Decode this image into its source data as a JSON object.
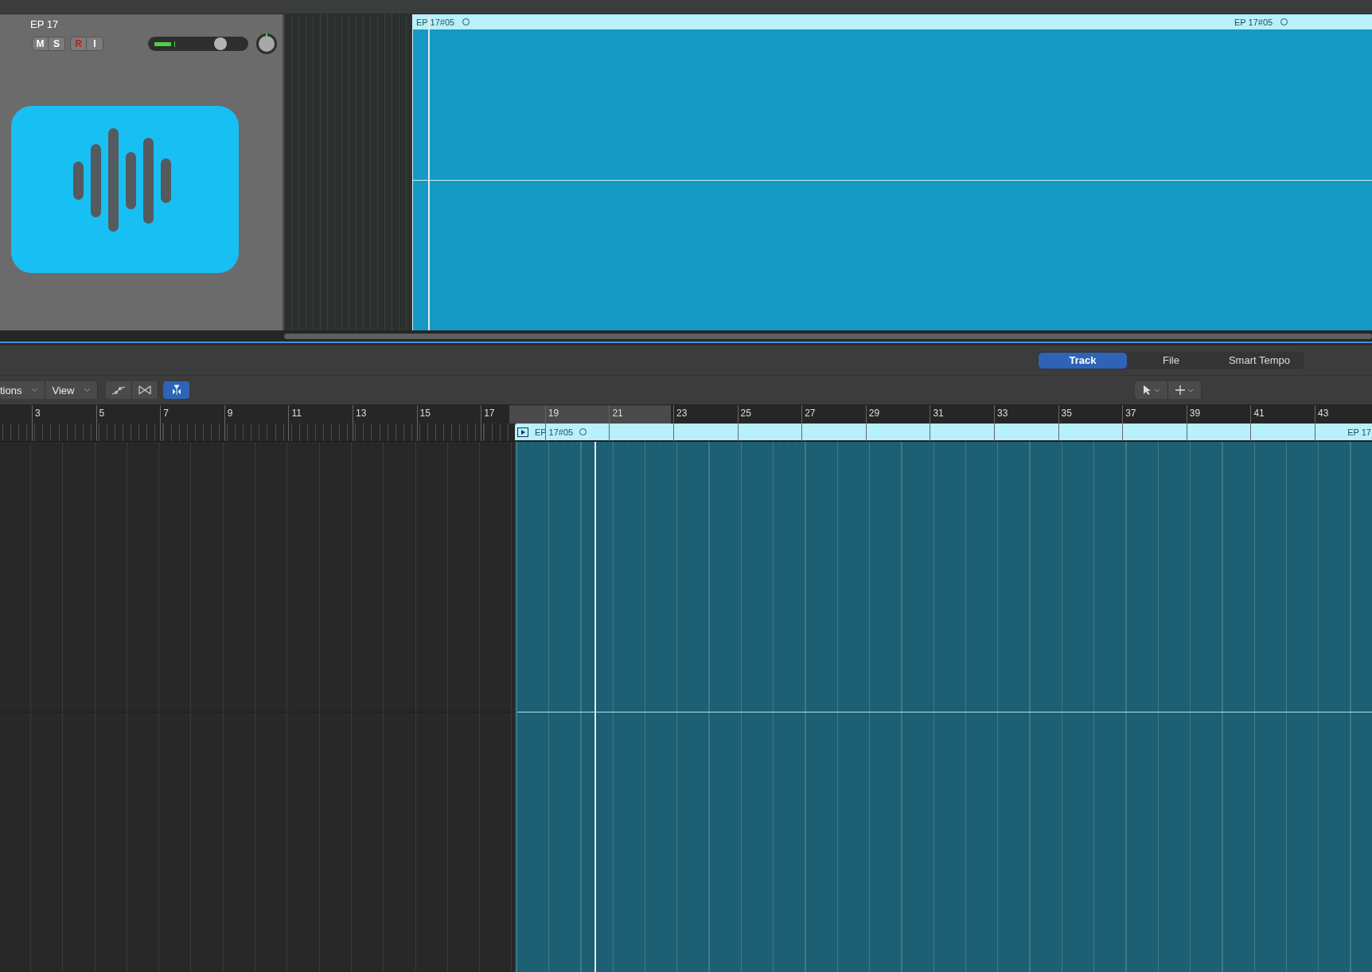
{
  "track_header": {
    "name": "EP 17",
    "buttons": [
      {
        "label": "M",
        "kind": "mute",
        "on": false
      },
      {
        "label": "S",
        "kind": "solo",
        "on": false
      },
      {
        "label": "R",
        "kind": "record",
        "on": false
      },
      {
        "label": "I",
        "kind": "input",
        "on": false
      }
    ],
    "meter": {
      "level": 0.17
    },
    "volume": {
      "level": 0.72
    }
  },
  "top_region": {
    "labels": [
      "EP 17#05",
      "EP 17#05"
    ]
  },
  "tabs": [
    {
      "label": "Track",
      "selected": true
    },
    {
      "label": "File",
      "selected": false
    },
    {
      "label": "Smart Tempo",
      "selected": false
    }
  ],
  "toolbar": {
    "menus": [
      "tions",
      "View"
    ],
    "catch_on": true
  },
  "ruler": {
    "bars": [
      "3",
      "5",
      "7",
      "9",
      "11",
      "13",
      "15",
      "17",
      "19",
      "21",
      "23",
      "25",
      "27",
      "29",
      "31",
      "33",
      "35",
      "37",
      "39",
      "41",
      "43"
    ]
  },
  "bottom_region": {
    "labels": [
      "EP 17#05",
      "EP 17"
    ]
  }
}
